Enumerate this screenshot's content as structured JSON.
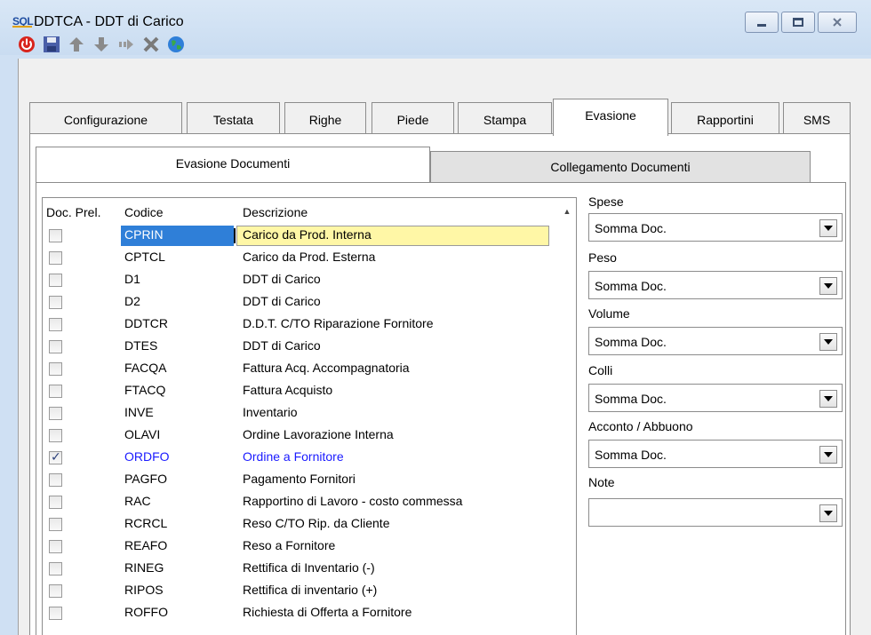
{
  "window": {
    "logo_text": "SQL",
    "title": "DDTCA - DDT di Carico",
    "controls": [
      "minimize",
      "maximize",
      "close"
    ]
  },
  "toolbar": {
    "icons": [
      "power-icon",
      "save-icon",
      "arrow-up-icon",
      "arrow-down-icon",
      "exit-icon",
      "delete-icon",
      "globe-icon"
    ]
  },
  "tabs": [
    {
      "label": "Configurazione",
      "active": false
    },
    {
      "label": "Testata",
      "active": false
    },
    {
      "label": "Righe",
      "active": false
    },
    {
      "label": "Piede",
      "active": false
    },
    {
      "label": "Stampa",
      "active": false
    },
    {
      "label": "Evasione",
      "active": true
    },
    {
      "label": "Rapportini",
      "active": false
    },
    {
      "label": "SMS",
      "active": false
    }
  ],
  "subtabs": [
    {
      "label": "Evasione Documenti",
      "active": true
    },
    {
      "label": "Collegamento Documenti",
      "active": false
    }
  ],
  "grid": {
    "columns": [
      "Doc. Prel.",
      "Codice",
      "Descrizione"
    ],
    "rows": [
      {
        "checked": false,
        "code": "CPRIN",
        "desc": "Carico da Prod. Interna",
        "selected": true
      },
      {
        "checked": false,
        "code": "CPTCL",
        "desc": "Carico da Prod. Esterna"
      },
      {
        "checked": false,
        "code": "D1",
        "desc": "DDT di Carico"
      },
      {
        "checked": false,
        "code": "D2",
        "desc": "DDT di Carico"
      },
      {
        "checked": false,
        "code": "DDTCR",
        "desc": "D.D.T. C/TO Riparazione Fornitore"
      },
      {
        "checked": false,
        "code": "DTES",
        "desc": "DDT di Carico"
      },
      {
        "checked": false,
        "code": "FACQA",
        "desc": "Fattura Acq. Accompagnatoria"
      },
      {
        "checked": false,
        "code": "FTACQ",
        "desc": "Fattura Acquisto"
      },
      {
        "checked": false,
        "code": "INVE",
        "desc": "Inventario"
      },
      {
        "checked": false,
        "code": "OLAVI",
        "desc": "Ordine Lavorazione Interna"
      },
      {
        "checked": true,
        "code": "ORDFO",
        "desc": "Ordine a Fornitore",
        "highlight": true
      },
      {
        "checked": false,
        "code": "PAGFO",
        "desc": "Pagamento Fornitori"
      },
      {
        "checked": false,
        "code": "RAC",
        "desc": "Rapportino di Lavoro - costo commessa"
      },
      {
        "checked": false,
        "code": "RCRCL",
        "desc": "Reso C/TO Rip. da Cliente"
      },
      {
        "checked": false,
        "code": "REAFO",
        "desc": "Reso a Fornitore"
      },
      {
        "checked": false,
        "code": "RINEG",
        "desc": "Rettifica di Inventario (-)"
      },
      {
        "checked": false,
        "code": "RIPOS",
        "desc": "Rettifica di inventario (+)"
      },
      {
        "checked": false,
        "code": "ROFFO",
        "desc": "Richiesta di Offerta a Fornitore"
      }
    ]
  },
  "fields": [
    {
      "label": "Spese",
      "value": "Somma Doc."
    },
    {
      "label": "Peso",
      "value": "Somma Doc."
    },
    {
      "label": "Volume",
      "value": "Somma Doc."
    },
    {
      "label": "Colli",
      "value": "Somma Doc."
    },
    {
      "label": "Acconto / Abbuono",
      "value": "Somma Doc."
    },
    {
      "label": "Note",
      "value": ""
    }
  ],
  "colors": {
    "selection_blue": "#2f7fd8",
    "edit_yellow": "#fff7a6",
    "highlight_text": "#1a1aff",
    "title_bar": "#cfe0f3"
  }
}
